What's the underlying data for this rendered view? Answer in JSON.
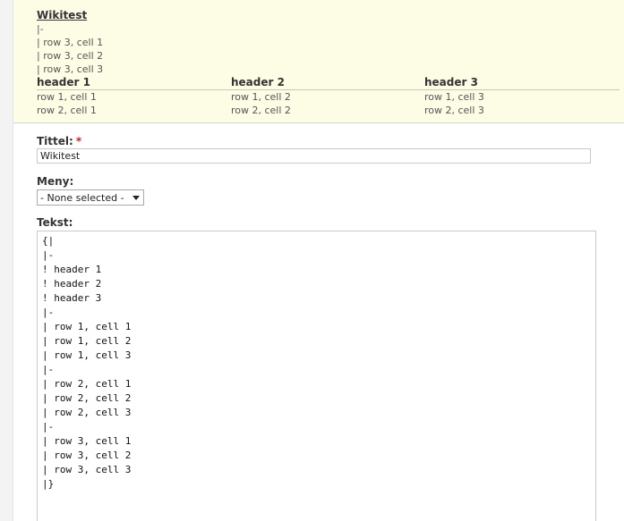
{
  "preview": {
    "title": "Wikitest",
    "raw_lines": [
      "|-",
      "| row 3, cell 1",
      "| row 3, cell 2",
      "| row 3, cell 3"
    ],
    "table": {
      "headers": [
        "header 1",
        "header 2",
        "header 3"
      ],
      "rows": [
        [
          "row 1, cell 1",
          "row 1, cell 2",
          "row 1, cell 3"
        ],
        [
          "row 2, cell 1",
          "row 2, cell 2",
          "row 2, cell 3"
        ]
      ]
    }
  },
  "form": {
    "title_label": "Tittel:",
    "required_mark": "*",
    "title_value": "Wikitest",
    "menu_label": "Meny:",
    "menu_selected": "- None selected -",
    "text_label": "Tekst:",
    "text_lines": [
      "{|",
      "|-",
      "! header 1",
      "! header 2",
      "! header 3",
      "|-",
      "| row 1, cell 1",
      "| row 1, cell 2",
      "| row 1, cell 3",
      "|-",
      "| row 2, cell 1",
      "| row 2, cell 2",
      "| row 2, cell 3",
      "|-",
      "| row 3, cell 1",
      "| row 3, cell 2",
      "| row 3, cell 3",
      "|}"
    ]
  }
}
